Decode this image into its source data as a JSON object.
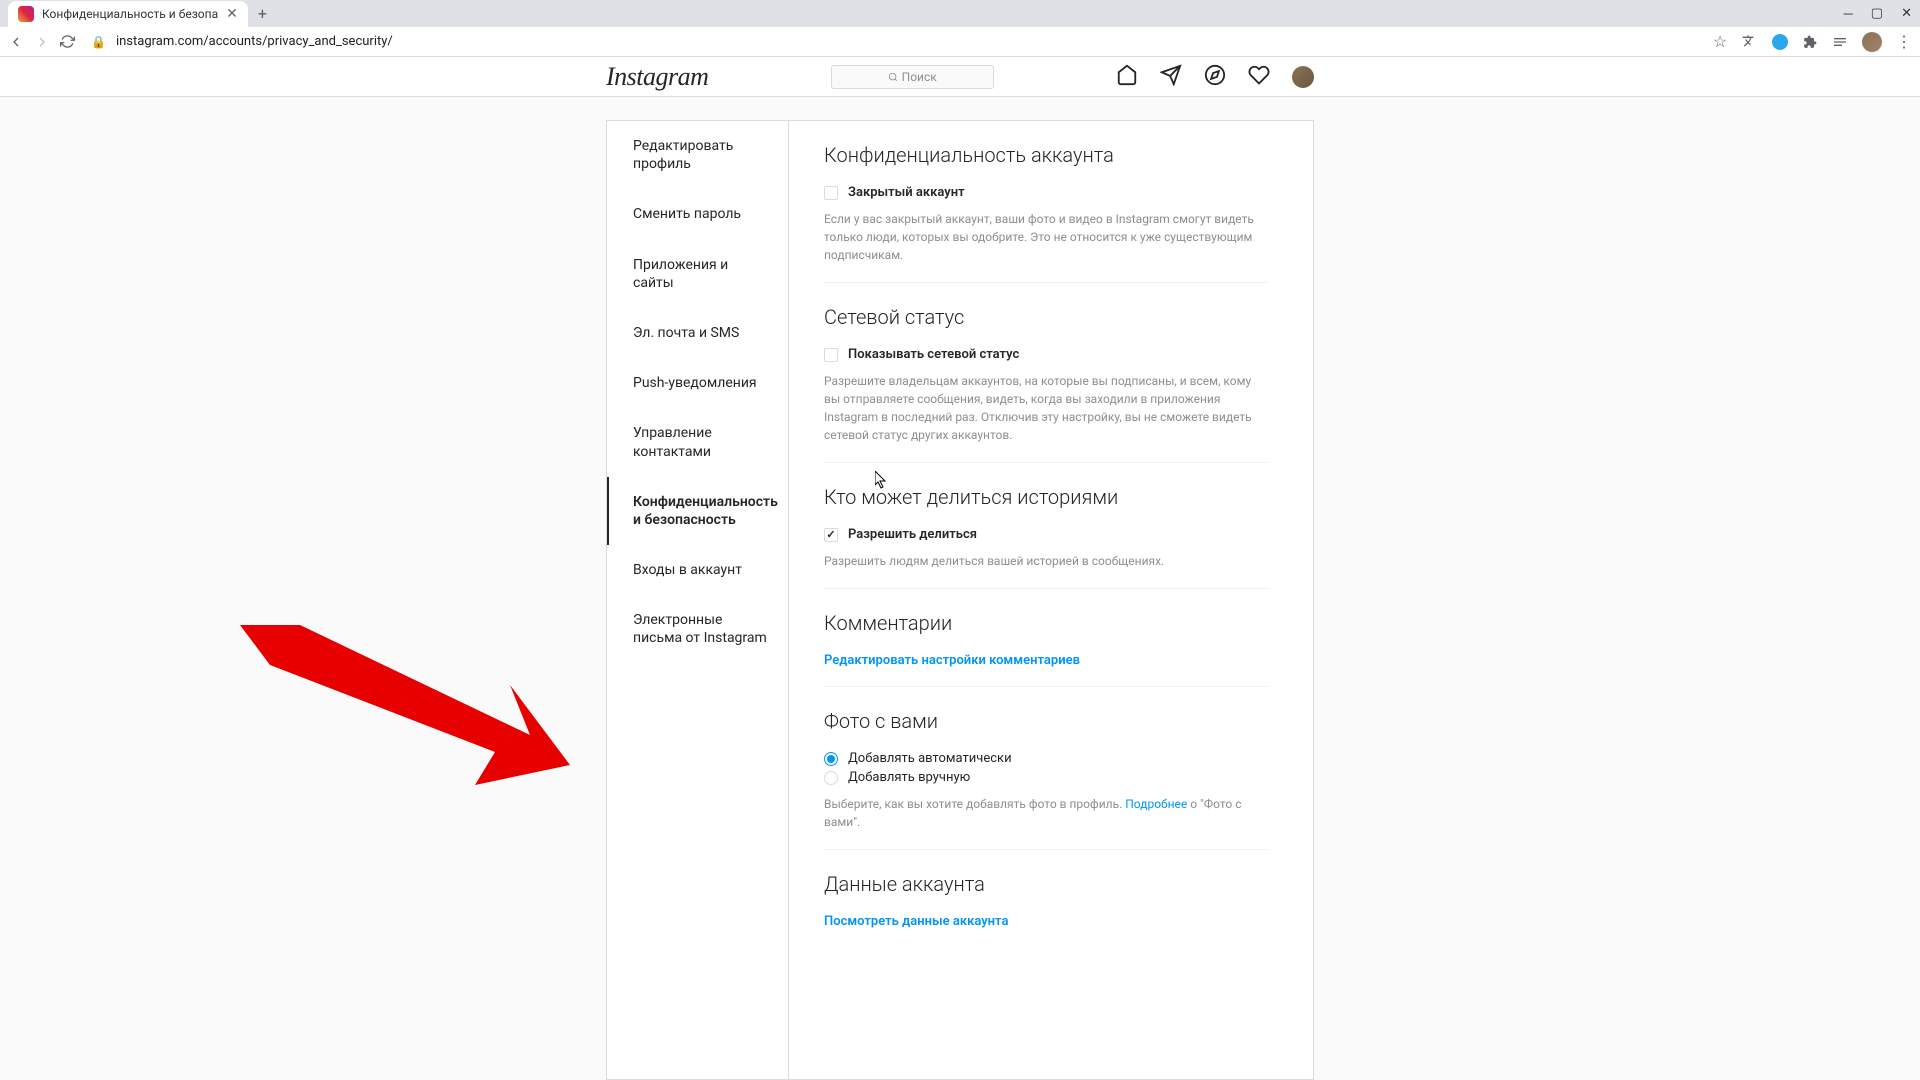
{
  "browser": {
    "tab_title": "Конфиденциальность и безопа",
    "url": "instagram.com/accounts/privacy_and_security/"
  },
  "header": {
    "logo": "Instagram",
    "search_placeholder": "Поиск"
  },
  "sidebar": {
    "items": [
      {
        "label": "Редактировать профиль"
      },
      {
        "label": "Сменить пароль"
      },
      {
        "label": "Приложения и сайты"
      },
      {
        "label": "Эл. почта и SMS"
      },
      {
        "label": "Push-уведомления"
      },
      {
        "label": "Управление контактами"
      },
      {
        "label": "Конфиденциальность и безопасность"
      },
      {
        "label": "Входы в аккаунт"
      },
      {
        "label": "Электронные письма от Instagram"
      }
    ]
  },
  "sections": {
    "privacy": {
      "title": "Конфиденциальность аккаунта",
      "checkbox": "Закрытый аккаунт",
      "help": "Если у вас закрытый аккаунт, ваши фото и видео в Instagram смогут видеть только люди, которых вы одобрите. Это не относится к уже существующим подписчикам."
    },
    "activity": {
      "title": "Сетевой статус",
      "checkbox": "Показывать сетевой статус",
      "help": "Разрешите владельцам аккаунтов, на которые вы подписаны, и всем, кому вы отправляете сообщения, видеть, когда вы заходили в приложения Instagram в последний раз. Отключив эту настройку, вы не сможете видеть сетевой статус других аккаунтов."
    },
    "story": {
      "title": "Кто может делиться историями",
      "checkbox": "Разрешить делиться",
      "help": "Разрешить людям делиться вашей историей в сообщениях."
    },
    "comments": {
      "title": "Комментарии",
      "link": "Редактировать настройки комментариев"
    },
    "photos": {
      "title": "Фото с вами",
      "option1": "Добавлять автоматически",
      "option2": "Добавлять вручную",
      "help_prefix": "Выберите, как вы хотите добавлять фото в профиль. ",
      "help_link": "Подробнее",
      "help_suffix": " о \"Фото с вами\"."
    },
    "data": {
      "title": "Данные аккаунта",
      "link": "Посмотреть данные аккаунта"
    }
  }
}
